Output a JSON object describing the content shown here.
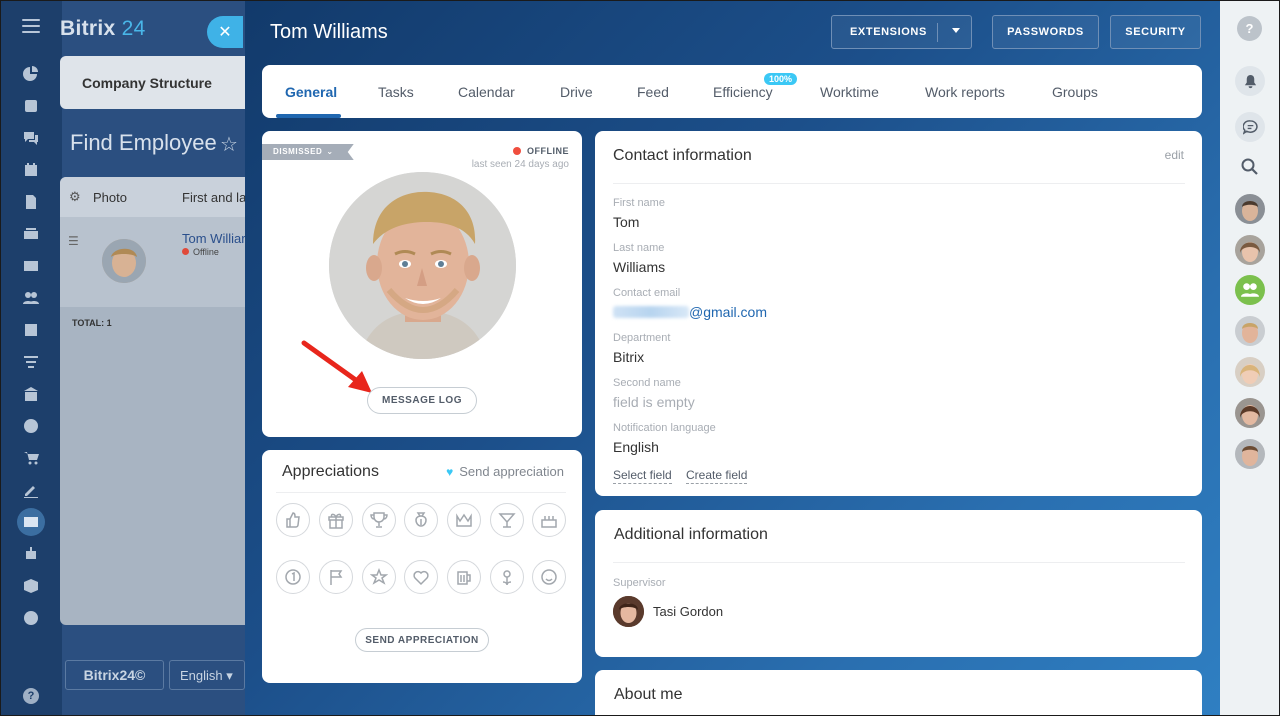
{
  "app": {
    "logo_text": "Bitrix",
    "logo_number": "24",
    "footer_logo": "Bitrix24©",
    "footer_language": "English ▾"
  },
  "background": {
    "company_structure": "Company Structure",
    "find_employee": "Find Employee",
    "table_header_photo": "Photo",
    "table_header_name": "First and la",
    "row_name": "Tom Williar",
    "row_status": "Offline",
    "total": "TOTAL: 1"
  },
  "slider": {
    "title": "Tom Williams",
    "buttons": {
      "extensions": "EXTENSIONS",
      "passwords": "PASSWORDS",
      "security": "SECURITY"
    },
    "tabs": [
      "General",
      "Tasks",
      "Calendar",
      "Drive",
      "Feed",
      "Efficiency",
      "Worktime",
      "Work reports",
      "Groups"
    ],
    "efficiency_badge": "100%"
  },
  "profile": {
    "status_tag": "DISMISSED",
    "presence": "OFFLINE",
    "last_seen": "last seen 24 days ago",
    "message_log_button": "MESSAGE LOG"
  },
  "appreciations": {
    "title": "Appreciations",
    "send_link": "Send appreciation",
    "send_button": "SEND APPRECIATION",
    "icons": [
      "thumbs-up",
      "gift",
      "cup",
      "money-bag",
      "crown",
      "cocktail",
      "cake",
      "number-one",
      "flag",
      "star",
      "heart",
      "beer",
      "flower",
      "smile"
    ]
  },
  "contact": {
    "title": "Contact information",
    "edit": "edit",
    "fields": [
      {
        "label": "First name",
        "value": "Tom"
      },
      {
        "label": "Last name",
        "value": "Williams"
      },
      {
        "label": "Contact email",
        "value": "@gmail.com"
      },
      {
        "label": "Department",
        "value": "Bitrix"
      },
      {
        "label": "Second name",
        "value": "field is empty"
      },
      {
        "label": "Notification language",
        "value": "English"
      }
    ],
    "select_field": "Select field",
    "create_field": "Create field"
  },
  "additional": {
    "title": "Additional information",
    "supervisor_label": "Supervisor",
    "supervisor_name": "Tasi Gordon"
  },
  "about": {
    "title": "About me"
  },
  "colors": {
    "accent": "#2067b0",
    "offline_dot": "#f04e3e",
    "badge": "#3bc8f5",
    "arrow": "#e8261c"
  }
}
